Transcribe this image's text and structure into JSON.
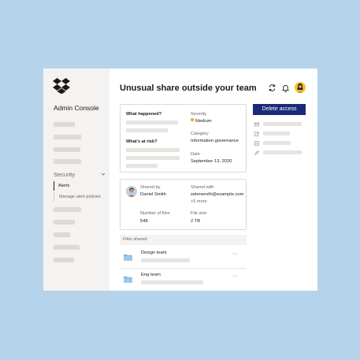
{
  "sidebar": {
    "title": "Admin Console",
    "security_label": "Security",
    "alerts_label": "Alerts",
    "manage_label": "Manage alert policies"
  },
  "header": {
    "title": "Unusual share outside your team",
    "icons": [
      "refresh-icon",
      "bell-icon",
      "avatar"
    ]
  },
  "alert_card": {
    "what_happened_label": "What happened?",
    "whats_at_risk_label": "What's at risk?",
    "severity_label": "Severity",
    "severity_value": "Medium",
    "category_label": "Category",
    "category_value": "Information governance",
    "date_label": "Date",
    "date_value": "September 13, 2020"
  },
  "share_card": {
    "shared_by_label": "Shared by",
    "shared_by_value": "Daniel Smith",
    "shared_with_label": "Shared with",
    "shared_with_value": "seleneroth@example.com",
    "more_label": "+5 more",
    "num_files_label": "Number of files",
    "num_files_value": "548",
    "file_size_label": "File size",
    "file_size_value": "2 TB"
  },
  "files": {
    "header": "Files shared",
    "items": [
      {
        "name": "Design team",
        "more": "···"
      },
      {
        "name": "Eng team",
        "more": "···"
      }
    ]
  },
  "actions": {
    "delete_label": "Delete access"
  },
  "colors": {
    "background": "#b5d3ea",
    "sidebar": "#f4f3f2",
    "primary_button": "#1a2a79",
    "brand_logo": "#1e1919",
    "severity_medium": "#f29d38",
    "avatar": "#f7c325",
    "folder": "#7fb7e3"
  }
}
